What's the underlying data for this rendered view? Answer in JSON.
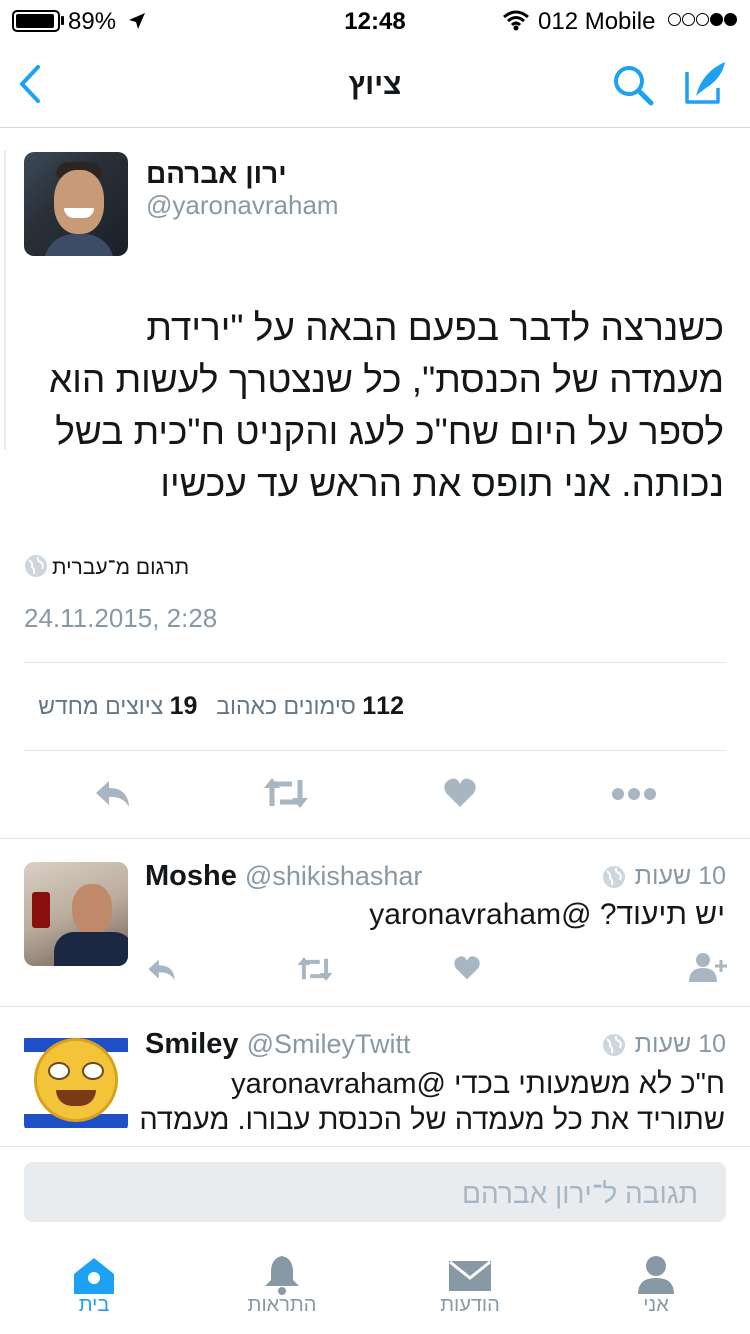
{
  "status": {
    "battery_percent": "89%",
    "time": "12:48",
    "carrier": "012 Mobile"
  },
  "nav": {
    "title": "ציוץ",
    "back_icon": "chevron-left-icon",
    "search_icon": "search-icon",
    "compose_icon": "compose-icon"
  },
  "tweet": {
    "display_name": "ירון אברהם",
    "handle": "@yaronavraham",
    "lines": [
      "כשנרצה לדבר בפעם הבאה על \"ירידת",
      "מעמדה של הכנסת\", כל שנצטרך לעשות הוא",
      "לספר על היום שח\"כ לעג והקניט ח\"כית בשל",
      "נכותה. אני תופס את הראש עד עכשיו"
    ],
    "translate": "תרגום מ־עברית",
    "timestamp": "24.11.2015, 2:28",
    "likes_count": "112",
    "likes_label": "סימונים כאהוב",
    "retweets_count": "19",
    "retweets_label": "ציוצים מחדש"
  },
  "replies": [
    {
      "name": "Moshe",
      "handle": "@shikishashar",
      "time": "10 שעות",
      "mention": "@yaronavraham",
      "text": "יש תיעוד?"
    },
    {
      "name": "Smiley",
      "handle": "@SmileyTwitt",
      "time": "10 שעות",
      "mention": "@yaronavraham",
      "line1": "ח\"כ לא משמעותי בכדי",
      "line2": "שתוריד את כל מעמדה של הכנסת עבורו. מעמדה"
    }
  ],
  "reply_box": {
    "placeholder": "תגובה ל־ירון אברהם"
  },
  "tabs": [
    {
      "label": "בית",
      "icon": "home-icon"
    },
    {
      "label": "התראות",
      "icon": "bell-icon"
    },
    {
      "label": "הודעות",
      "icon": "envelope-icon"
    },
    {
      "label": "אני",
      "icon": "person-icon"
    }
  ],
  "colors": {
    "accent": "#1da1f2",
    "muted": "#8899a6"
  }
}
